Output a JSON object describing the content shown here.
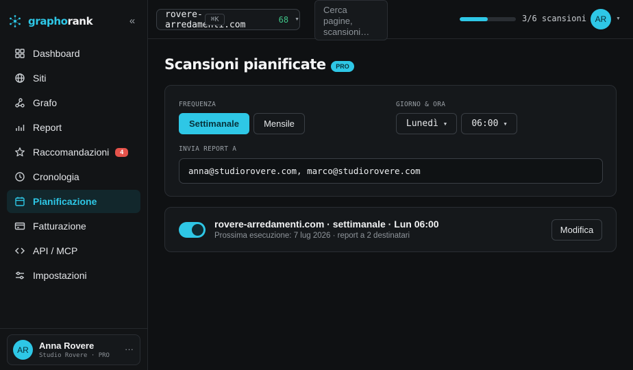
{
  "brand": {
    "part1": "grapho",
    "part2": "rank",
    "collapse_icon": "«"
  },
  "sidebar": {
    "items": [
      {
        "label": "Dashboard",
        "icon": "grid-icon",
        "active": false
      },
      {
        "label": "Siti",
        "icon": "globe-icon",
        "active": false
      },
      {
        "label": "Grafo",
        "icon": "graph-icon",
        "active": false
      },
      {
        "label": "Report",
        "icon": "bar-chart-icon",
        "active": false
      },
      {
        "label": "Raccomandazioni",
        "icon": "star-icon",
        "active": false,
        "badge": "4"
      },
      {
        "label": "Cronologia",
        "icon": "clock-icon",
        "active": false
      },
      {
        "label": "Pianificazione",
        "icon": "calendar-icon",
        "active": true
      },
      {
        "label": "Fatturazione",
        "icon": "credit-card-icon",
        "active": false
      },
      {
        "label": "API / MCP",
        "icon": "code-icon",
        "active": false
      },
      {
        "label": "Impostazioni",
        "icon": "sliders-icon",
        "active": false
      }
    ]
  },
  "user": {
    "initials": "AR",
    "name": "Anna Rovere",
    "subtitle": "Studio Rovere · PRO",
    "more": "···"
  },
  "topbar": {
    "site_name": "rovere-arredamenti.com",
    "site_score": "68",
    "search_placeholder": "Cerca pagine, scansioni…",
    "shortcut": "⌘K",
    "scan_progress": 0.5,
    "scan_label": "3/6 scansioni",
    "avatar_initials": "AR"
  },
  "page": {
    "title": "Scansioni pianificate",
    "badge": "PRO"
  },
  "schedule_form": {
    "frequency_label": "FREQUENZA",
    "frequency_options": [
      "Settimanale",
      "Mensile"
    ],
    "frequency_selected": "Settimanale",
    "day_time_label": "GIORNO & ORA",
    "day": "Lunedì",
    "time": "06:00",
    "recipients_label": "INVIA REPORT A",
    "recipients": "anna@studiorovere.com, marco@studiorovere.com"
  },
  "scheduled": {
    "enabled": true,
    "title": "rovere-arredamenti.com · settimanale · Lun 06:00",
    "subtitle": "Prossima esecuzione: 7 lug 2026 · report a 2 destinatari",
    "edit_label": "Modifica"
  },
  "colors": {
    "accent": "#2ec7e6",
    "background": "#0f1113",
    "badge_red": "#e5534b",
    "score_green": "#3fc488"
  }
}
